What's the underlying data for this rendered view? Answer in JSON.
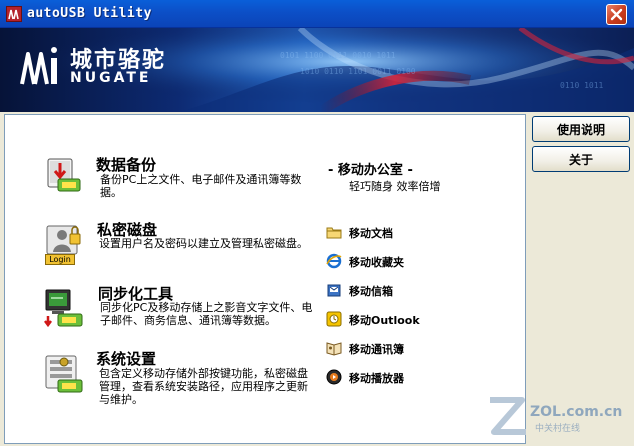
{
  "window": {
    "title": "autoUSB Utility"
  },
  "banner": {
    "brand_cn": "城市骆驼",
    "brand_en": "NUGATE"
  },
  "sidebar": {
    "help_label": "使用说明",
    "about_label": "关于"
  },
  "features": [
    {
      "title": "数据备份",
      "desc": "备份PC上之文件、电子邮件及通讯簿等数据。",
      "icon": "backup-icon"
    },
    {
      "title": "私密磁盘",
      "desc": "设置用户名及密码以建立及管理私密磁盘。",
      "icon": "login-icon",
      "icon_label": "Login"
    },
    {
      "title": "同步化工具",
      "desc": "同步化PC及移动存储上之影音文字文件、电子邮件、商务信息、通讯簿等数据。",
      "icon": "sync-icon"
    },
    {
      "title": "系统设置",
      "desc": "包含定义移动存储外部按键功能，私密磁盘管理，查看系统安装路径，应用程序之更新与维护。",
      "icon": "settings-icon"
    }
  ],
  "mobile_office": {
    "title": "- 移动办公室 -",
    "subtitle": "轻巧随身  效率倍增",
    "links": [
      {
        "label": "移动文档",
        "icon": "folder-icon"
      },
      {
        "label": "移动收藏夹",
        "icon": "ie-icon"
      },
      {
        "label": "移动信箱",
        "icon": "mail-icon"
      },
      {
        "label": "移动Outlook",
        "icon": "outlook-icon"
      },
      {
        "label": "移动通讯簿",
        "icon": "addressbook-icon"
      },
      {
        "label": "移动播放器",
        "icon": "player-icon"
      }
    ]
  },
  "watermark": {
    "brand": "ZOL.com.cn",
    "sub": "中关村在线"
  }
}
